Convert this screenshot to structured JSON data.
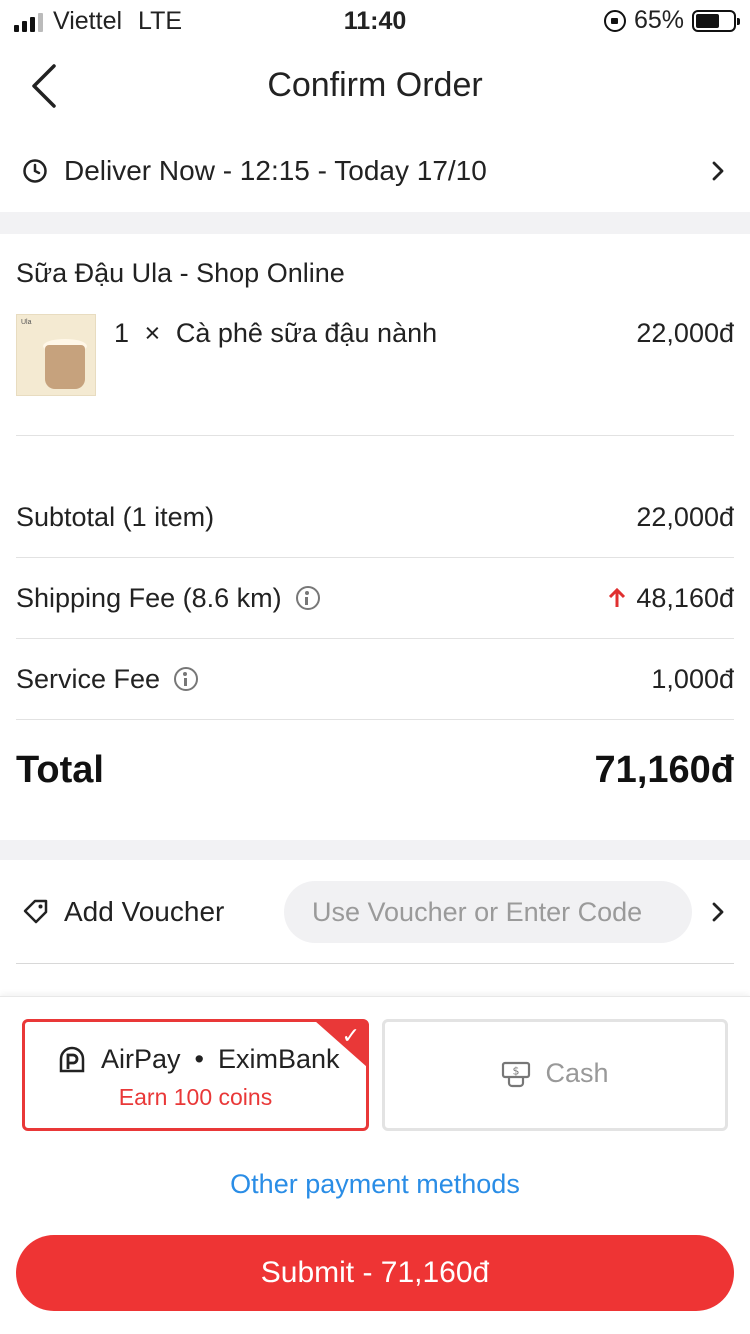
{
  "status_bar": {
    "carrier": "Viettel",
    "network": "LTE",
    "time": "11:40",
    "battery": "65%"
  },
  "header": {
    "title": "Confirm Order"
  },
  "delivery": {
    "text": "Deliver Now - 12:15 - Today 17/10"
  },
  "shop": {
    "name": "Sữa Đậu Ula - Shop Online"
  },
  "items": [
    {
      "qty": "1",
      "times": "×",
      "name": "Cà phê sữa đậu nành",
      "price": "22,000đ"
    }
  ],
  "summary": {
    "subtotal_label": "Subtotal (1 item)",
    "subtotal_value": "22,000đ",
    "shipping_label": "Shipping Fee (8.6 km)",
    "shipping_value": "48,160đ",
    "service_label": "Service Fee",
    "service_value": "1,000đ",
    "total_label": "Total",
    "total_value": "71,160đ"
  },
  "voucher": {
    "label": "Add Voucher",
    "placeholder": "Use Voucher or Enter Code"
  },
  "payment": {
    "airpay_name": "AirPay",
    "airpay_sep": "•",
    "airpay_bank": "EximBank",
    "airpay_note": "Earn 100 coins",
    "cash_label": "Cash",
    "other_methods": "Other payment methods",
    "selected": "airpay"
  },
  "submit": {
    "label": "Submit - 71,160đ"
  },
  "colors": {
    "accent": "#ee3434",
    "link": "#2a8de6",
    "bg_gap": "#f2f2f4"
  }
}
